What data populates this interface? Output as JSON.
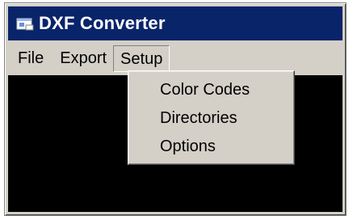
{
  "window": {
    "title": "DXF Converter",
    "title_bar_color": "#0a246a",
    "app_icon": "app-window-icon"
  },
  "menubar": {
    "items": [
      {
        "label": "File"
      },
      {
        "label": "Export"
      },
      {
        "label": "Setup",
        "active": true
      }
    ]
  },
  "setup_menu": {
    "items": [
      {
        "label": "Color Codes"
      },
      {
        "label": "Directories"
      },
      {
        "label": "Options"
      }
    ]
  },
  "client_area": {
    "background": "#000000"
  }
}
